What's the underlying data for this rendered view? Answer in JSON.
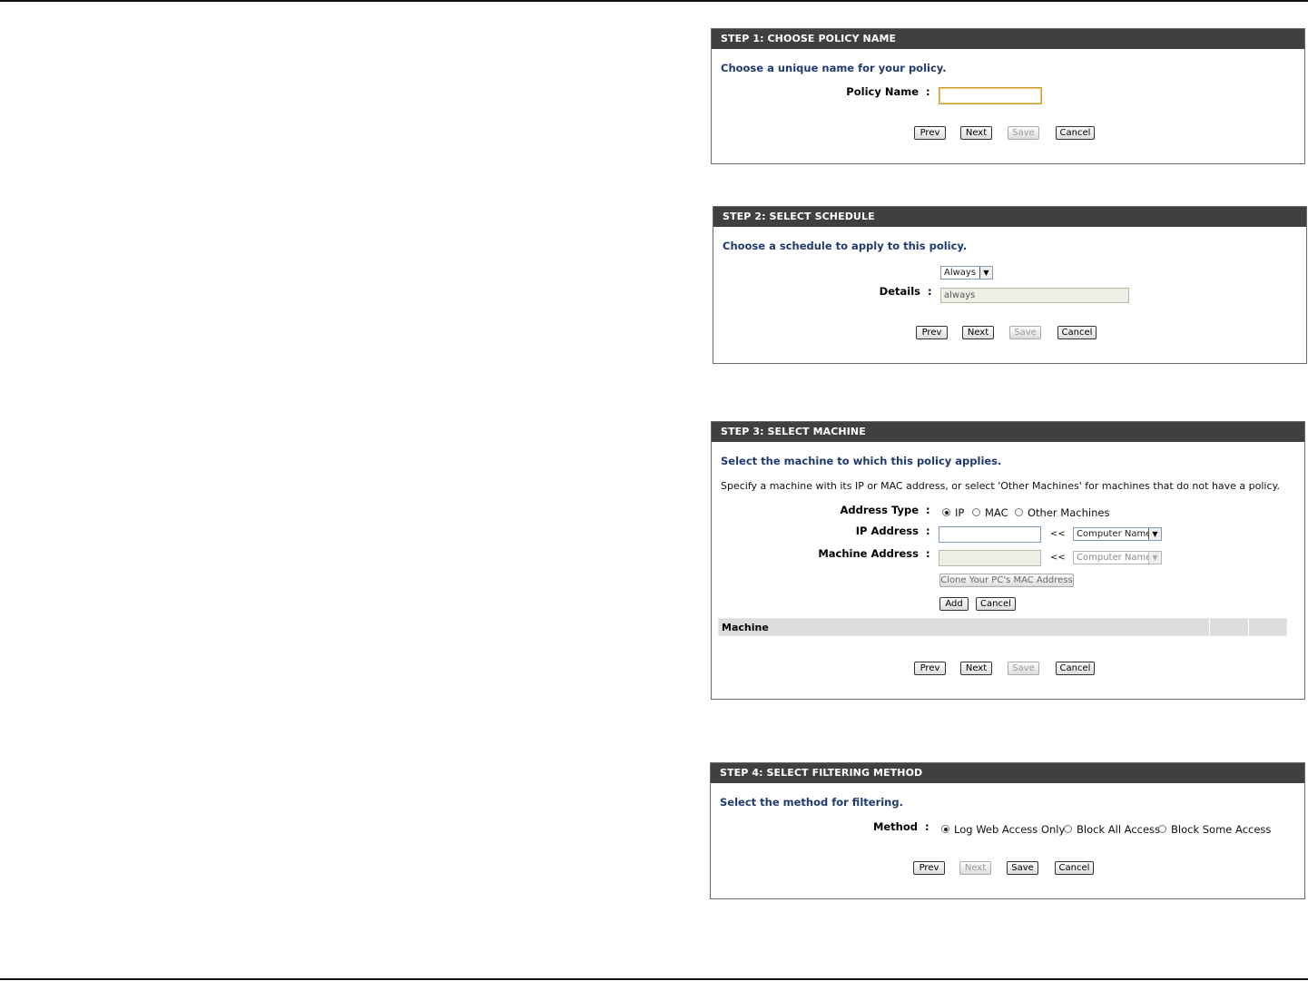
{
  "step1": {
    "title": "STEP 1: CHOOSE POLICY NAME",
    "instruction": "Choose a unique name for your policy.",
    "policy_name_label": "Policy Name",
    "policy_name_value": "",
    "buttons": {
      "prev": "Prev",
      "next": "Next",
      "save": "Save",
      "cancel": "Cancel"
    }
  },
  "step2": {
    "title": "STEP 2: SELECT SCHEDULE",
    "instruction": "Choose a schedule to apply to this policy.",
    "schedule_selected": "Always",
    "details_label": "Details",
    "details_value": "always",
    "buttons": {
      "prev": "Prev",
      "next": "Next",
      "save": "Save",
      "cancel": "Cancel"
    }
  },
  "step3": {
    "title": "STEP 3: SELECT MACHINE",
    "instruction": "Select the machine to which this policy applies.",
    "description": "Specify a machine with its IP or MAC address, or select 'Other Machines' for machines that do not have a policy.",
    "address_type_label": "Address Type",
    "address_type_options": [
      "IP",
      "MAC",
      "Other Machines"
    ],
    "address_type_selected": "IP",
    "ip_address_label": "IP Address",
    "ip_address_value": "",
    "machine_address_label": "Machine Address",
    "machine_address_value": "",
    "arrow_symbol": "<<",
    "computer_name_select": "Computer Name",
    "clone_mac_button": "Clone Your PC's MAC Address",
    "add_button": "Add",
    "cancel_inline_button": "Cancel",
    "table_header": "Machine",
    "buttons": {
      "prev": "Prev",
      "next": "Next",
      "save": "Save",
      "cancel": "Cancel"
    }
  },
  "step4": {
    "title": "STEP 4: SELECT FILTERING METHOD",
    "instruction": "Select the method for filtering.",
    "method_label": "Method",
    "method_options": [
      "Log Web Access Only",
      "Block All Access",
      "Block Some Access"
    ],
    "method_selected": "Log Web Access Only",
    "buttons": {
      "prev": "Prev",
      "next": "Next",
      "save": "Save",
      "cancel": "Cancel"
    }
  },
  "separator": ":",
  "icons": {
    "dropdown": "chevron-down-icon",
    "radio": "radio-icon"
  }
}
